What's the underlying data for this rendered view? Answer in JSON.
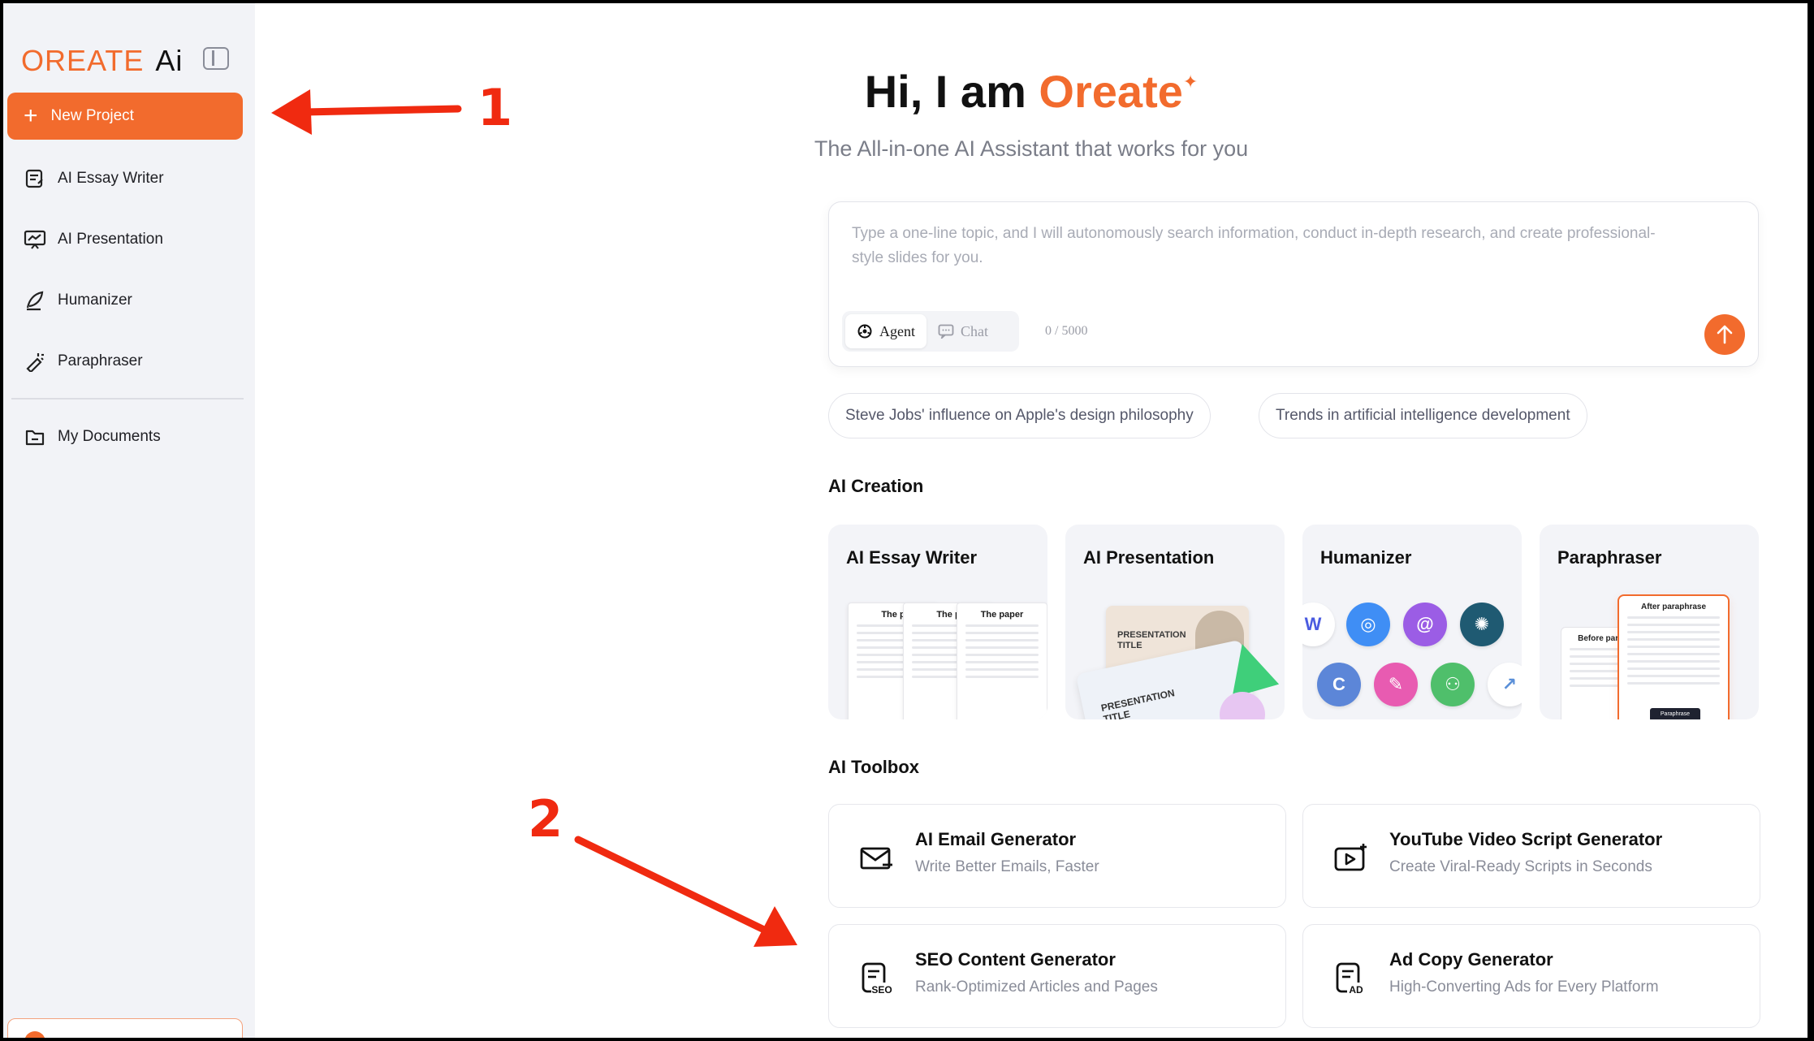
{
  "brand": {
    "logo_main": "OREATE",
    "logo_ai": "Ai"
  },
  "sidebar": {
    "new_project": "New Project",
    "items": [
      {
        "label": "AI Essay Writer",
        "icon": "essay-icon"
      },
      {
        "label": "AI Presentation",
        "icon": "presentation-icon"
      },
      {
        "label": "Humanizer",
        "icon": "humanizer-icon"
      },
      {
        "label": "Paraphraser",
        "icon": "paraphraser-icon"
      },
      {
        "label": "My Documents",
        "icon": "folder-icon"
      }
    ]
  },
  "hero": {
    "title_prefix": "Hi, I am ",
    "title_brand": "Oreate",
    "subtitle": "The All-in-one AI Assistant that works for you"
  },
  "prompt": {
    "placeholder": "Type a one-line topic, and I will autonomously search information, conduct in-depth research, and create professional-style slides for you.",
    "mode_agent": "Agent",
    "mode_chat": "Chat",
    "char_count": "0 / 5000"
  },
  "suggestions": [
    "Steve Jobs' influence on Apple's design philosophy",
    "Trends in artificial intelligence development"
  ],
  "ai_creation": {
    "title": "AI Creation",
    "cards": [
      {
        "title": "AI Essay Writer",
        "doc_titles": [
          "The p",
          "The p",
          "The paper"
        ]
      },
      {
        "title": "AI Presentation",
        "back_text": "PRESENTATION TITLE",
        "front_text": "PRESENTATION TITLE"
      },
      {
        "title": "Humanizer"
      },
      {
        "title": "Paraphraser",
        "before_label": "Before paraph",
        "after_label": "After paraphrase",
        "button_label": "Paraphrase"
      }
    ]
  },
  "ai_toolbox": {
    "title": "AI Toolbox",
    "tools": [
      {
        "title": "AI Email Generator",
        "subtitle": "Write Better Emails, Faster",
        "icon": "email-icon"
      },
      {
        "title": "YouTube Video Script Generator",
        "subtitle": "Create Viral-Ready Scripts in Seconds",
        "icon": "video-icon"
      },
      {
        "title": "SEO Content Generator",
        "subtitle": "Rank-Optimized Articles and Pages",
        "icon": "seo-icon"
      },
      {
        "title": "Ad Copy Generator",
        "subtitle": "High-Converting Ads for Every Platform",
        "icon": "ad-icon"
      }
    ]
  },
  "annotations": {
    "one": "1",
    "two": "2"
  },
  "colors": {
    "accent": "#f26b2d",
    "annotation": "#f02a10",
    "sidebar_bg": "#f2f3f7"
  }
}
